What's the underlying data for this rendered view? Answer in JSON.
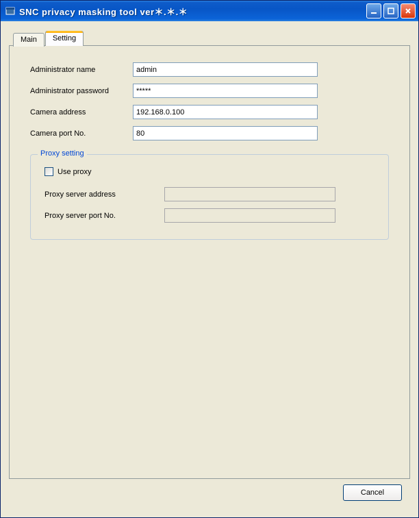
{
  "window": {
    "title": "SNC privacy masking tool ver＊.＊.＊"
  },
  "tabs": {
    "main": "Main",
    "setting": "Setting"
  },
  "form": {
    "admin_name_label": "Administrator name",
    "admin_name_value": "admin",
    "admin_password_label": "Administrator password",
    "admin_password_value": "*****",
    "camera_address_label": "Camera address",
    "camera_address_value": "192.168.0.100",
    "camera_port_label": "Camera port No.",
    "camera_port_value": "80"
  },
  "proxy": {
    "legend": "Proxy setting",
    "use_proxy_label": "Use proxy",
    "server_address_label": "Proxy server address",
    "server_port_label": "Proxy server port No."
  },
  "buttons": {
    "cancel": "Cancel"
  }
}
